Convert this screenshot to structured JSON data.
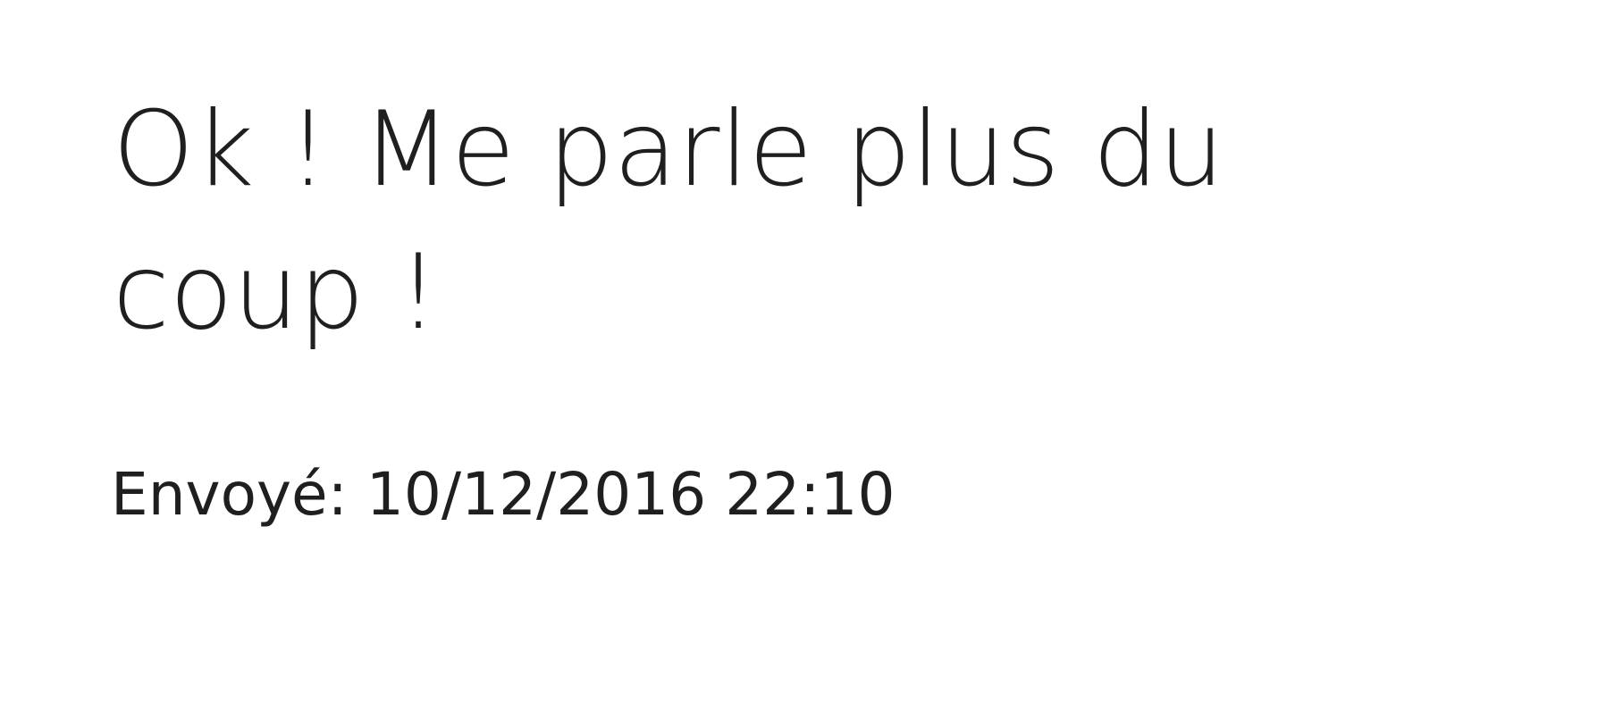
{
  "message": {
    "text": "Ok ! Me parle plus du coup !",
    "sent_label": "Envoyé: ",
    "sent_value": "10/12/2016 22:10"
  }
}
